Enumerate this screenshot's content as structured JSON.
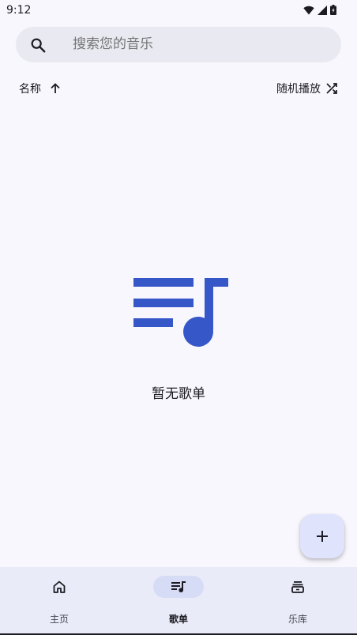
{
  "status": {
    "time": "9:12"
  },
  "search": {
    "placeholder": "搜索您的音乐"
  },
  "sort": {
    "label": "名称",
    "shuffle_label": "随机播放"
  },
  "empty": {
    "message": "暂无歌单"
  },
  "nav": {
    "items": [
      {
        "label": "主页",
        "icon": "home-icon",
        "active": false
      },
      {
        "label": "歌单",
        "icon": "playlist-icon",
        "active": true
      },
      {
        "label": "乐库",
        "icon": "library-icon",
        "active": false
      }
    ]
  },
  "colors": {
    "accent": "#3557c8",
    "background": "#f8f7fd",
    "nav_bg": "#e9ebf8",
    "fab_bg": "#dfe3fb"
  }
}
